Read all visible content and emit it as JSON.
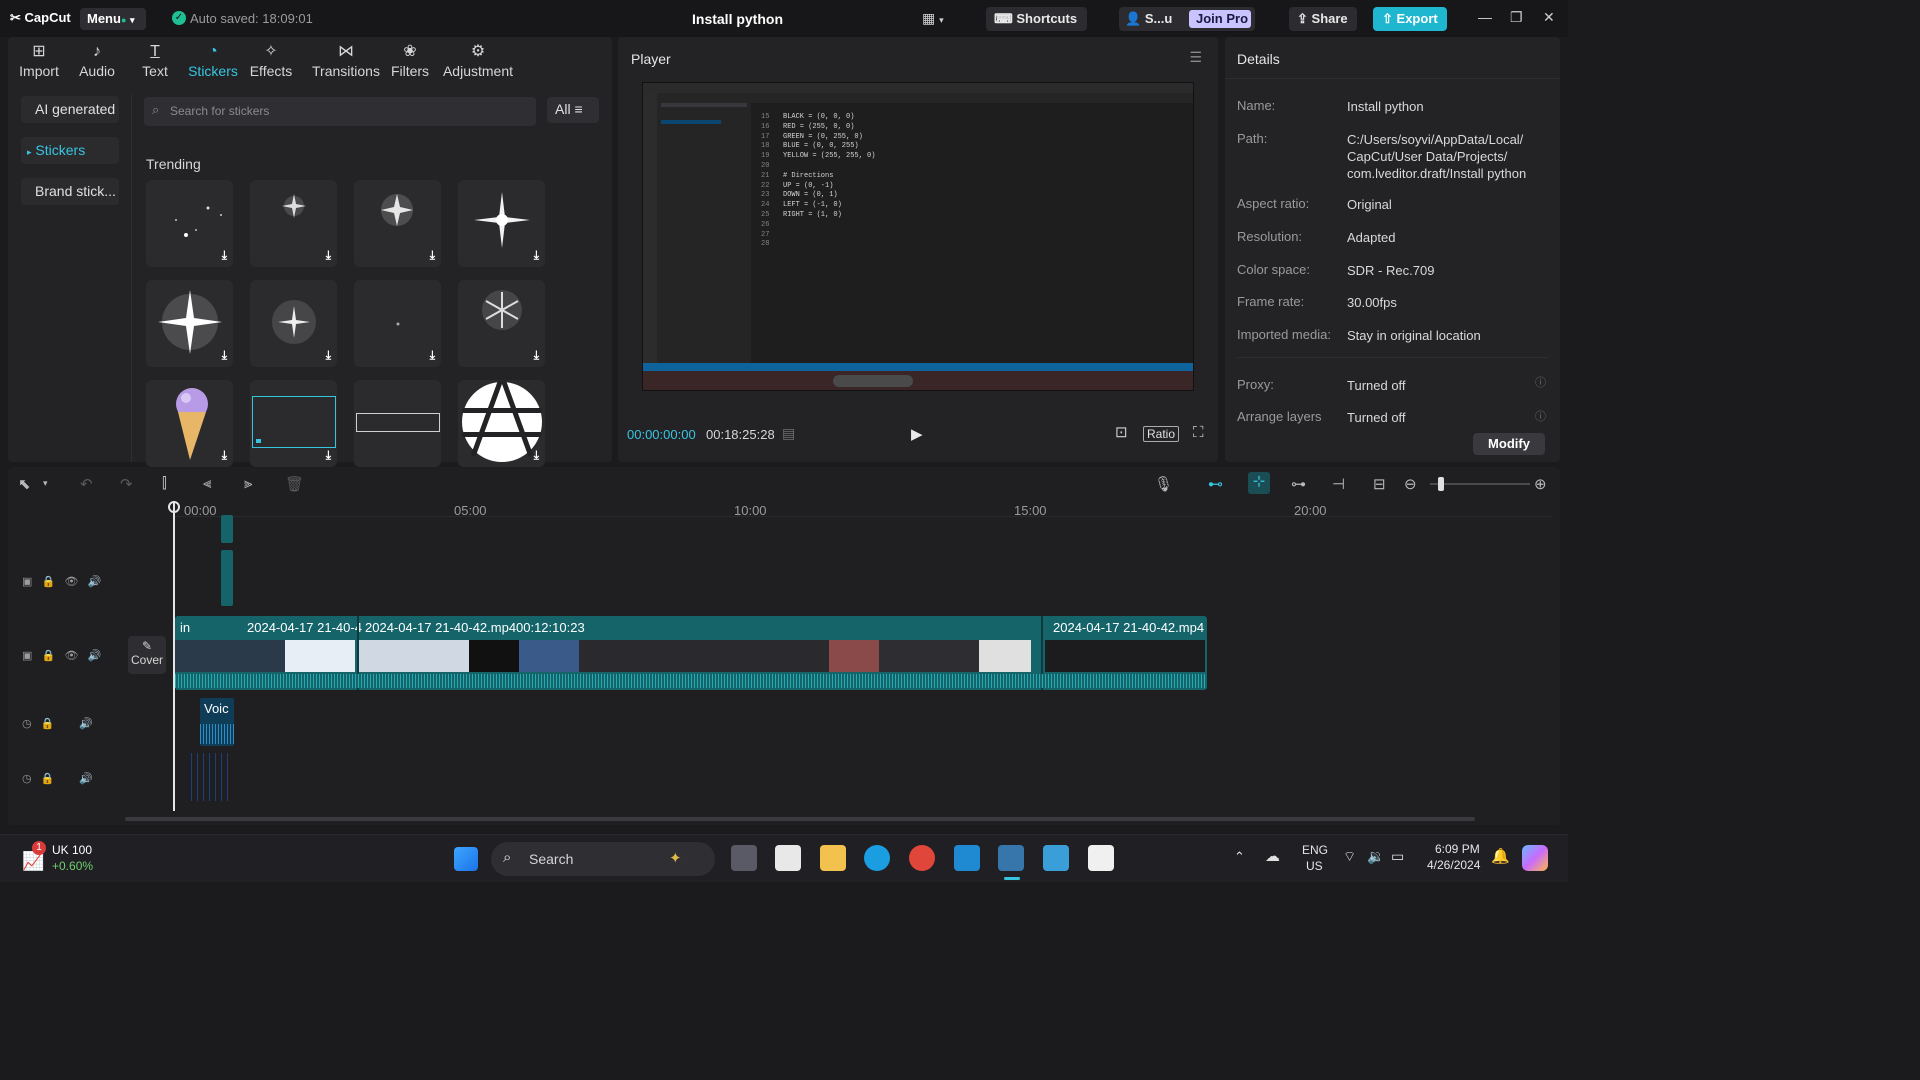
{
  "titlebar": {
    "logo": "CapCut",
    "menu_label": "Menu",
    "autosave": "Auto saved: 18:09:01",
    "project_title": "Install python",
    "shortcuts_label": "Shortcuts",
    "user_label": "S...u",
    "join_pro_label": "Join Pro",
    "share_label": "Share",
    "export_label": "Export"
  },
  "media_toolbar": [
    {
      "label": "Import",
      "icon": "import-icon"
    },
    {
      "label": "Audio",
      "icon": "audio-icon"
    },
    {
      "label": "Text",
      "icon": "text-icon"
    },
    {
      "label": "Stickers",
      "icon": "stickers-icon"
    },
    {
      "label": "Effects",
      "icon": "effects-icon"
    },
    {
      "label": "Transitions",
      "icon": "transitions-icon"
    },
    {
      "label": "Filters",
      "icon": "filters-icon"
    },
    {
      "label": "Adjustment",
      "icon": "adjustment-icon"
    }
  ],
  "stickers_side": [
    {
      "label": "AI generated"
    },
    {
      "label": "Stickers"
    },
    {
      "label": "Brand stick..."
    }
  ],
  "stickers_search": {
    "placeholder": "Search for stickers",
    "filter_label": "All"
  },
  "stickers_section": {
    "title": "Trending"
  },
  "player": {
    "title": "Player",
    "current_time": "00:00:00:00",
    "total_time": "00:18:25:28",
    "ratio_label": "Ratio",
    "code_lines": [
      "BLACK = (0, 0, 0)",
      "RED = (255, 0, 0)",
      "GREEN = (0, 255, 0)",
      "BLUE = (0, 0, 255)",
      "YELLOW = (255, 255, 0)",
      "",
      "# Directions",
      "UP = (0, -1)",
      "DOWN = (0, 1)",
      "LEFT = (-1, 0)",
      "RIGHT = (1, 0)",
      "",
      "",
      ""
    ],
    "line_numbers": [
      "15",
      "16",
      "17",
      "18",
      "19",
      "20",
      "21",
      "22",
      "23",
      "24",
      "25",
      "26",
      "27",
      "28"
    ]
  },
  "details": {
    "title": "Details",
    "rows": [
      {
        "label": "Name:",
        "value": "Install python"
      },
      {
        "label": "Path:",
        "value": "C:/Users/soyvi/AppData/Local/ CapCut/User Data/Projects/ com.lveditor.draft/Install python"
      },
      {
        "label": "Aspect ratio:",
        "value": "Original"
      },
      {
        "label": "Resolution:",
        "value": "Adapted"
      },
      {
        "label": "Color space:",
        "value": "SDR - Rec.709"
      },
      {
        "label": "Frame rate:",
        "value": "30.00fps"
      },
      {
        "label": "Imported media:",
        "value": "Stay in original location"
      },
      {
        "label": "Proxy:",
        "value": "Turned off"
      },
      {
        "label": "Arrange layers",
        "value": "Turned off"
      }
    ],
    "modify_label": "Modify"
  },
  "timeline": {
    "ruler": [
      "00:00",
      "05:00",
      "10:00",
      "15:00",
      "20:00"
    ],
    "cover_label": "Cover",
    "clip_labels": [
      "in",
      "2024-04-17 21-40-4",
      "2024-04-17 21-40-42.mp4",
      "00:12:10:23",
      "2024-04-17 21-40-42.mp4"
    ],
    "voice_label": "Voic"
  },
  "taskbar": {
    "stock_name": "UK 100",
    "stock_change": "+0.60%",
    "stock_badge": "1",
    "search_label": "Search",
    "lang_top": "ENG",
    "lang_bottom": "US",
    "time": "6:09 PM",
    "date": "4/26/2024"
  },
  "colors": {
    "accent": "#37c6e2",
    "export": "#1fb6cf",
    "clip": "#14646a",
    "join_pro": "#c9c3ff"
  }
}
